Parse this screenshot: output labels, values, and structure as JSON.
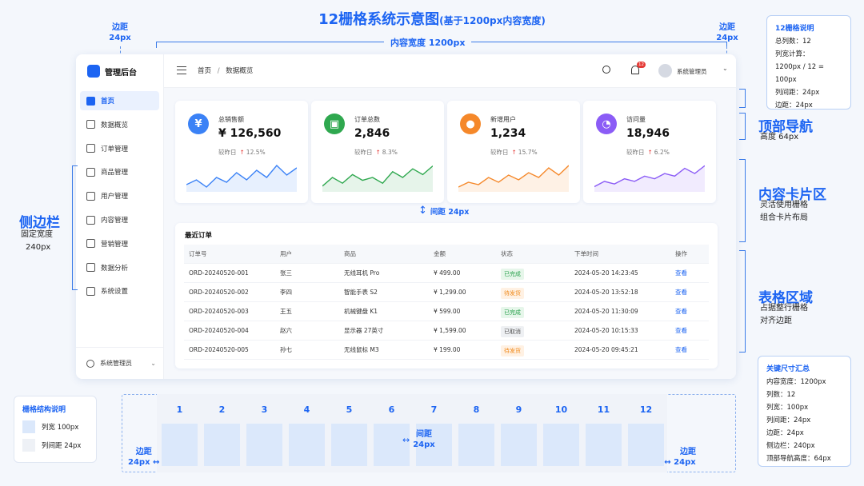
{
  "header": {
    "title": "12栅格系统示意图",
    "subtitle": "(基于1200px内容宽度)",
    "content_width_label": "内容宽度 1200px",
    "margin_left": [
      "边距",
      "24px"
    ],
    "margin_right": [
      "边距",
      "24px"
    ]
  },
  "info_box": {
    "title": "12栅格说明",
    "lines": [
      "总列数：12",
      "列宽计算：",
      "1200px / 12 = 100px",
      "列间距：24px",
      "边距：24px"
    ]
  },
  "app": {
    "logo_text": "管理后台",
    "sidebar": [
      {
        "label": "首页",
        "active": true
      },
      {
        "label": "数据概览"
      },
      {
        "label": "订单管理"
      },
      {
        "label": "商品管理"
      },
      {
        "label": "用户管理"
      },
      {
        "label": "内容管理"
      },
      {
        "label": "营销管理"
      },
      {
        "label": "数据分析"
      },
      {
        "label": "系统设置"
      }
    ],
    "sidebar_footer": "系统管理员",
    "breadcrumb": {
      "home": "首页",
      "sep": "/",
      "current": "数据概览"
    },
    "notification_count": "12",
    "user_name": "系统管理员",
    "stat_cards": [
      {
        "label": "总销售额",
        "value": "¥ 126,560",
        "compare": "较昨日",
        "change": "12.5%",
        "icon": "¥",
        "color": "#3b82f6",
        "trend": [
          10,
          12,
          9,
          13,
          11,
          15,
          12,
          16,
          13,
          18,
          14,
          17
        ]
      },
      {
        "label": "订单总数",
        "value": "2,846",
        "compare": "较昨日",
        "change": "8.3%",
        "icon": "bag-icon",
        "color": "#2fa84f",
        "trend": [
          9,
          12,
          10,
          13,
          11,
          12,
          10,
          14,
          12,
          15,
          13,
          16
        ]
      },
      {
        "label": "新增用户",
        "value": "1,234",
        "compare": "较昨日",
        "change": "15.7%",
        "icon": "user-icon",
        "color": "#f5882a",
        "trend": [
          8,
          10,
          9,
          12,
          10,
          13,
          11,
          14,
          12,
          16,
          13,
          17
        ]
      },
      {
        "label": "访问量",
        "value": "18,946",
        "compare": "较昨日",
        "change": "6.2%",
        "icon": "pie-icon",
        "color": "#8b5cf6",
        "trend": [
          9,
          11,
          10,
          12,
          11,
          13,
          12,
          14,
          13,
          16,
          14,
          17
        ]
      }
    ],
    "gap_label": "间距 24px",
    "table": {
      "title": "最近订单",
      "columns": [
        "订单号",
        "用户",
        "商品",
        "金额",
        "状态",
        "下单时间",
        "操作"
      ],
      "rows": [
        [
          "ORD-20240520-001",
          "张三",
          "无线耳机 Pro",
          "¥ 499.00",
          "已完成",
          "2024-05-20 14:23:45",
          "查看"
        ],
        [
          "ORD-20240520-002",
          "李四",
          "智能手表 S2",
          "¥ 1,299.00",
          "待发货",
          "2024-05-20 13:52:18",
          "查看"
        ],
        [
          "ORD-20240520-003",
          "王五",
          "机械键盘 K1",
          "¥ 599.00",
          "已完成",
          "2024-05-20 11:30:09",
          "查看"
        ],
        [
          "ORD-20240520-004",
          "赵六",
          "显示器 27英寸",
          "¥ 1,599.00",
          "已取消",
          "2024-05-20 10:15:33",
          "查看"
        ],
        [
          "ORD-20240520-005",
          "孙七",
          "无线鼠标 M3",
          "¥ 199.00",
          "待发货",
          "2024-05-20 09:45:21",
          "查看"
        ]
      ]
    }
  },
  "annotations": {
    "sidebar": {
      "title": "侧边栏",
      "lines": [
        "固定宽度",
        "240px"
      ]
    },
    "topnav": {
      "title": "顶部导航",
      "lines": [
        "高度 64px"
      ]
    },
    "cards": {
      "title": "内容卡片区",
      "lines": [
        "灵活使用栅格",
        "组合卡片布局"
      ]
    },
    "table": {
      "title": "表格区域",
      "lines": [
        "占据整行栅格",
        "对齐边距"
      ]
    }
  },
  "grid_legend": {
    "title": "栅格结构说明",
    "items": [
      "列宽 100px",
      "列间距 24px"
    ]
  },
  "grid_columns": [
    "1",
    "2",
    "3",
    "4",
    "5",
    "6",
    "7",
    "8",
    "9",
    "10",
    "11",
    "12"
  ],
  "grid_gap_label": [
    "间距",
    "24px"
  ],
  "grid_margin_left": [
    "边距",
    "24px"
  ],
  "grid_margin_right": [
    "边距",
    "24px"
  ],
  "summary": {
    "title": "关键尺寸汇总",
    "lines": [
      "内容宽度：1200px",
      "列数：12",
      "列宽：100px",
      "列间距：24px",
      "边距：24px",
      "侧边栏：240px",
      "顶部导航高度：64px"
    ]
  },
  "colors": {
    "accent": "#1c64f2",
    "grid": "#dbe8fb",
    "up": "#e53935"
  }
}
